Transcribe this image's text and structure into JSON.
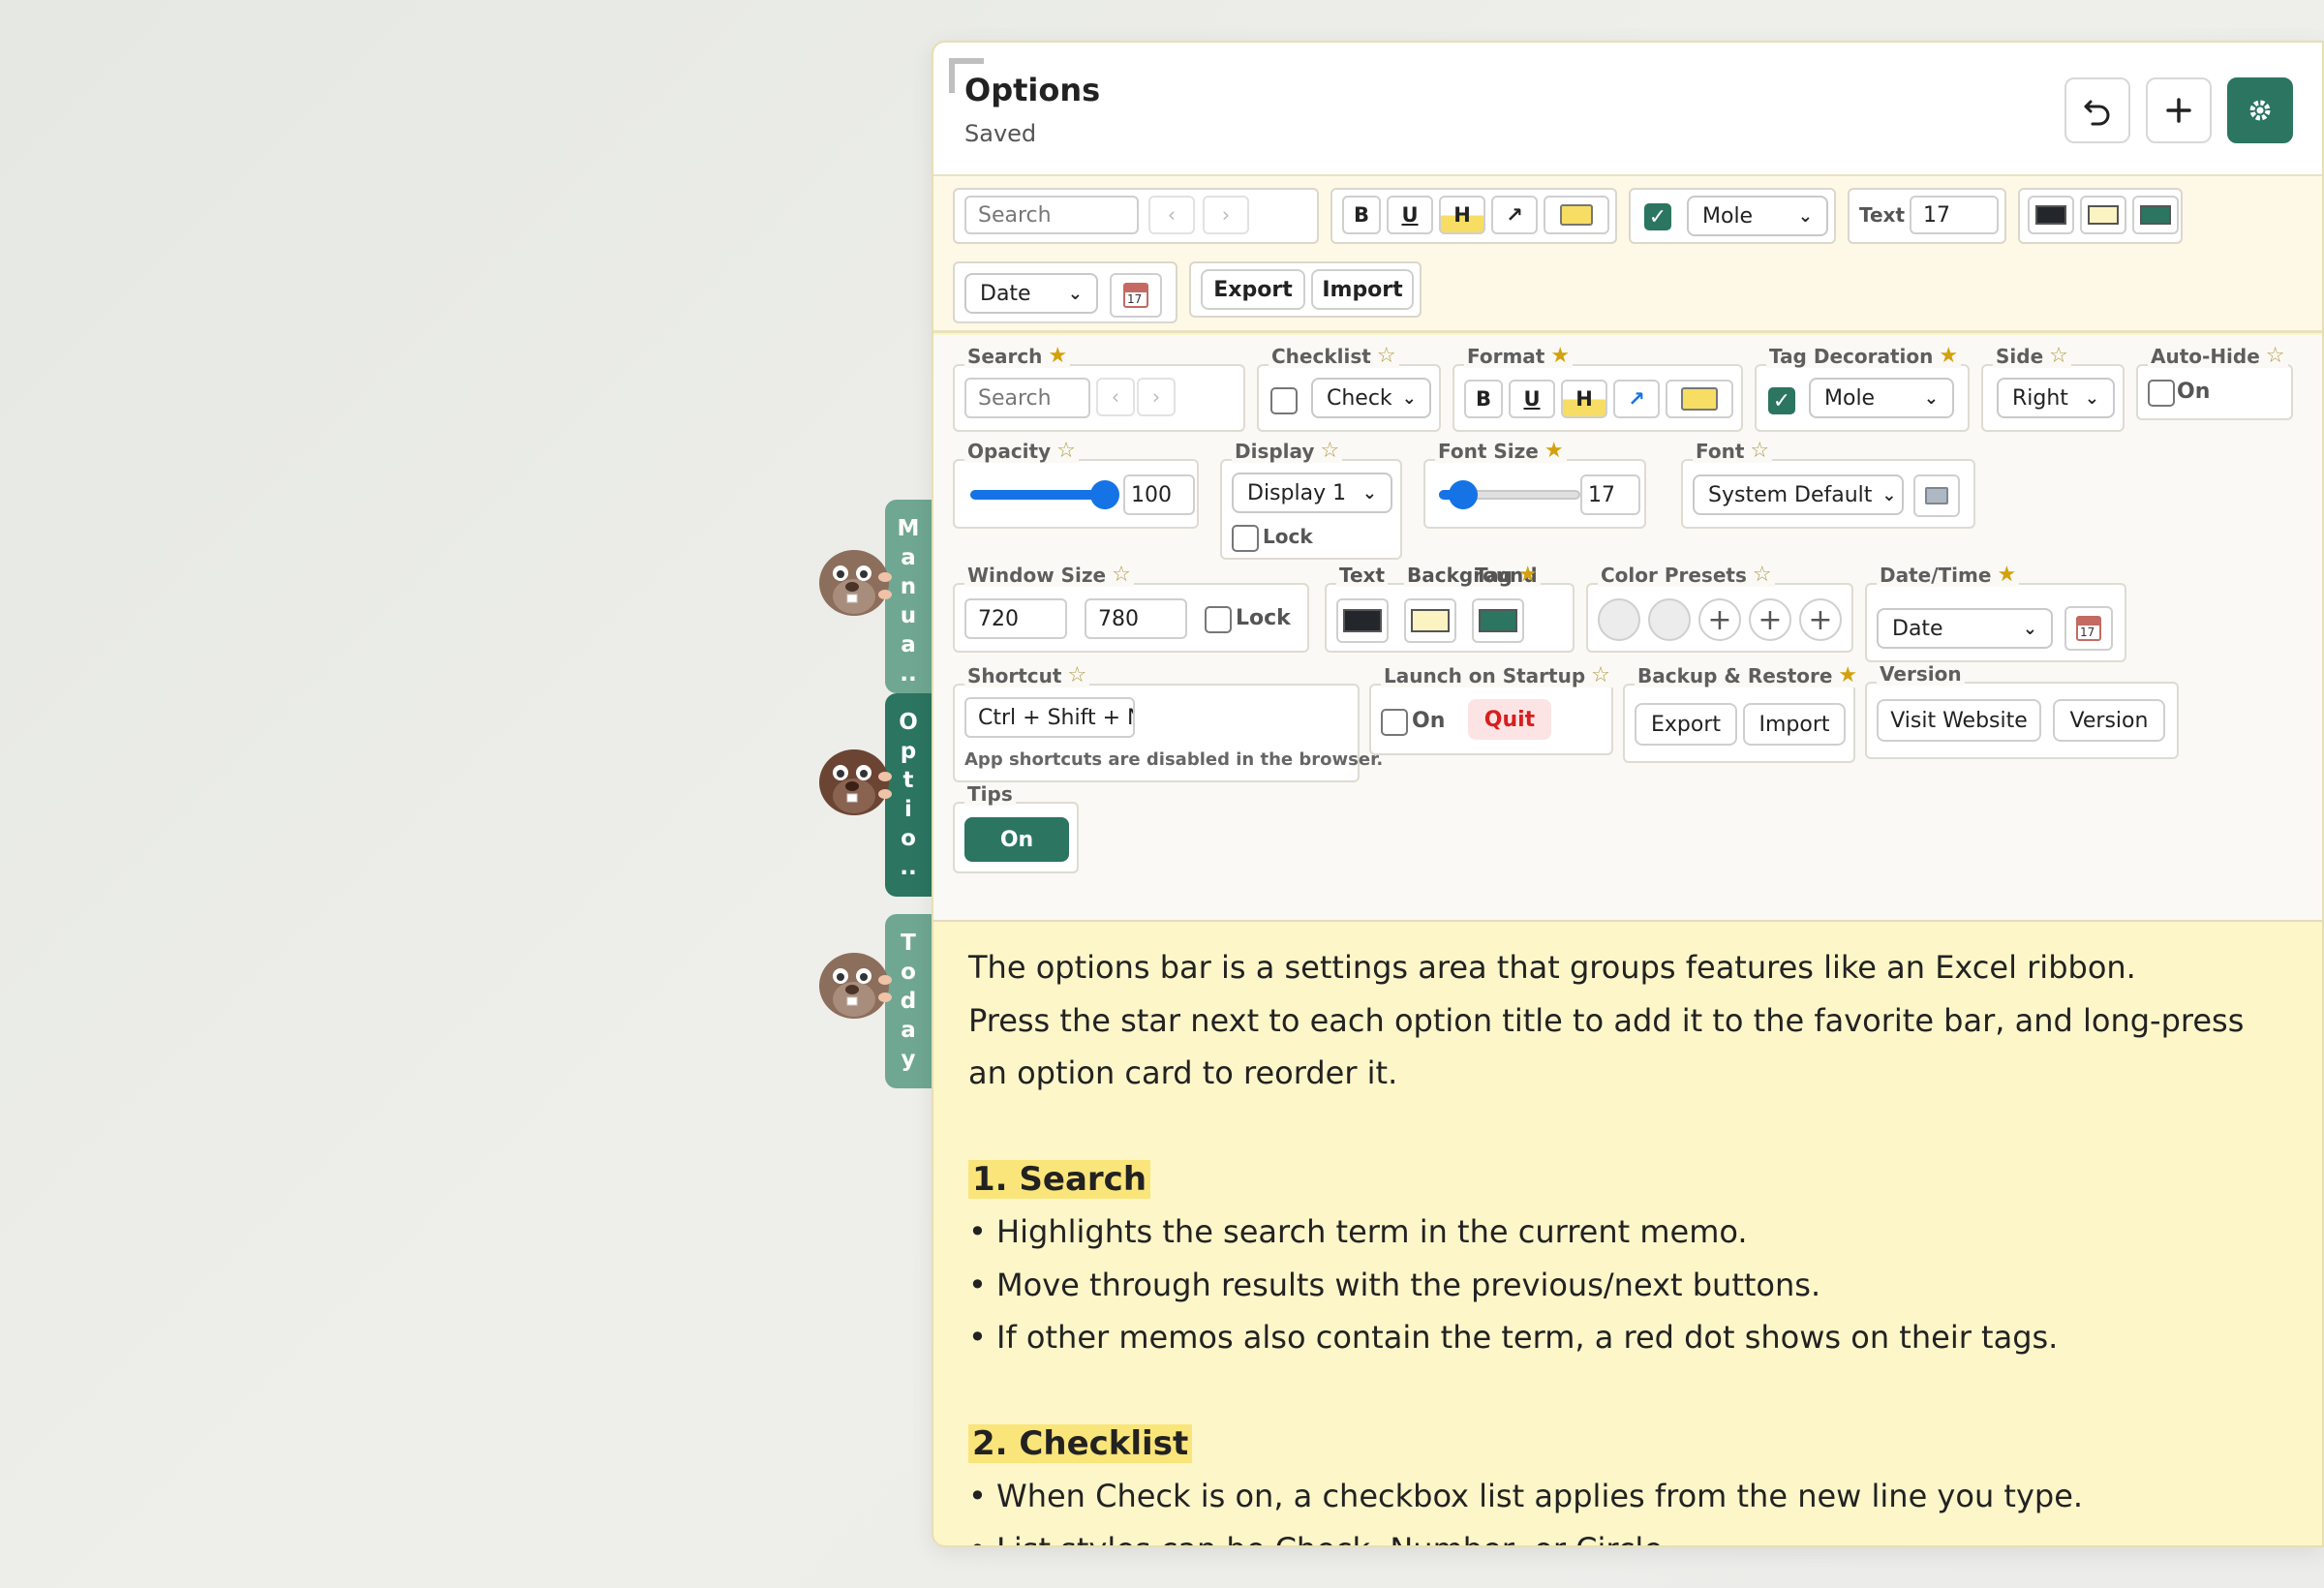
{
  "side_tabs": [
    {
      "label": "Manua..",
      "letters": [
        "M",
        "a",
        "n",
        "u",
        "a",
        ".."
      ],
      "active": false
    },
    {
      "label": "Optio..",
      "letters": [
        "O",
        "p",
        "t",
        "i",
        "o",
        ".."
      ],
      "active": true
    },
    {
      "label": "Today",
      "letters": [
        "T",
        "o",
        "d",
        "a",
        "y"
      ],
      "active": false
    }
  ],
  "window": {
    "title": "Options",
    "status": "Saved"
  },
  "titlebar_buttons": {
    "undo_icon": "undo-icon",
    "add_icon": "plus-icon",
    "settings_icon": "gear-icon"
  },
  "favbar": {
    "search_placeholder": "Search",
    "prev": "‹",
    "next": "›",
    "format": {
      "bold": "B",
      "underline": "U",
      "highlight": "H",
      "link": "↗"
    },
    "tag_style": "Mole",
    "text_label": "Text",
    "font_size": "17",
    "date_select": "Date",
    "cal_day": "17",
    "export": "Export",
    "import": "Import"
  },
  "options": {
    "search": {
      "title": "Search",
      "placeholder": "Search",
      "prev": "‹",
      "next": "›"
    },
    "checklist": {
      "title": "Checklist",
      "style": "Check"
    },
    "format": {
      "title": "Format",
      "bold": "B",
      "underline": "U",
      "highlight": "H",
      "link": "↗"
    },
    "tag_decoration": {
      "title": "Tag Decoration",
      "style": "Mole"
    },
    "side": {
      "title": "Side",
      "value": "Right"
    },
    "auto_hide": {
      "title": "Auto-Hide",
      "label": "On"
    },
    "opacity": {
      "title": "Opacity",
      "value": "100",
      "fraction": 1.0
    },
    "display": {
      "title": "Display",
      "value": "Display 1",
      "lock": "Lock"
    },
    "font_size": {
      "title": "Font Size",
      "value": "17",
      "fraction": 0.1
    },
    "font": {
      "title": "Font",
      "value": "System Default"
    },
    "window_size": {
      "title": "Window Size",
      "width": "720",
      "height": "780",
      "lock": "Lock"
    },
    "colors": {
      "text": "Text",
      "background": "Background",
      "tag": "Tag"
    },
    "color_presets": {
      "title": "Color Presets",
      "plus": "+"
    },
    "datetime": {
      "title": "Date/Time",
      "value": "Date",
      "cal_day": "17"
    },
    "shortcut": {
      "title": "Shortcut",
      "value": "Ctrl + Shift + N",
      "note": "App shortcuts are disabled in the browser."
    },
    "launch": {
      "title": "Launch on Startup",
      "on": "On",
      "quit": "Quit"
    },
    "backup": {
      "title": "Backup & Restore",
      "export": "Export",
      "import": "Import"
    },
    "version": {
      "title": "Version",
      "visit": "Visit Website",
      "version": "Version"
    },
    "tips": {
      "title": "Tips",
      "value": "On"
    }
  },
  "content": {
    "intro1": "The options bar is a settings area that groups features like an Excel ribbon.",
    "intro2": "Press the star next to each option title to add it to the favorite bar, and long-press an option card to reorder it.",
    "h1": "1. Search",
    "s1": [
      "• Highlights the search term in the current memo.",
      "• Move through results with the previous/next buttons.",
      "• If other memos also contain the term, a red dot shows on their tags."
    ],
    "h2": "2. Checklist",
    "s2": [
      "• When Check is on, a checkbox list applies from the new line you type.",
      "• List styles can be Check, Number, or Circle."
    ]
  },
  "colors": {
    "accent": "#2b7561",
    "note_bg": "#fdf6c9",
    "highlight": "#f7dd63",
    "star": "#d3a10c",
    "swatch_text": "#23262b",
    "swatch_bg": "#fbf3c2",
    "swatch_tag": "#2b7561"
  }
}
